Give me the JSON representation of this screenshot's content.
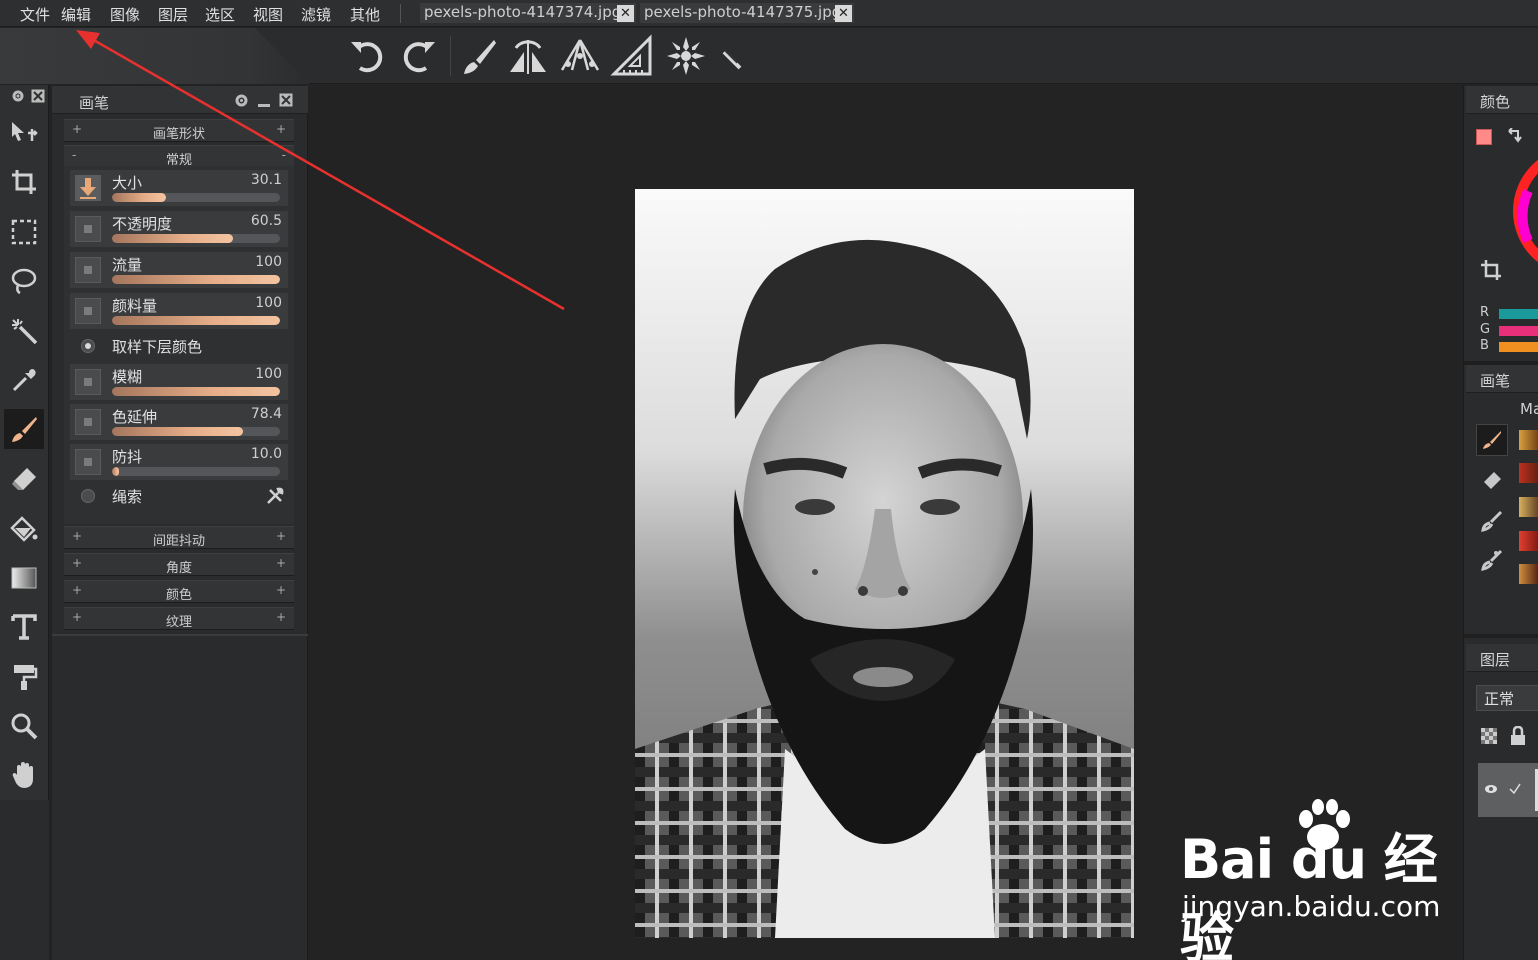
{
  "menubar": {
    "items": [
      "文件",
      "编辑",
      "图像",
      "图层",
      "选区",
      "视图",
      "滤镜",
      "其他"
    ],
    "tabs": [
      {
        "label": "pexels-photo-4147374.jpg"
      },
      {
        "label": "pexels-photo-4147375.jpg"
      }
    ]
  },
  "toolbar": {
    "buttons": [
      "undo-icon",
      "redo-icon",
      "brush-icon",
      "symmetry-icon",
      "perspective-icon",
      "ruler-icon",
      "mandala-icon",
      "pen-icon"
    ]
  },
  "tools": [
    "move-icon",
    "crop-icon",
    "marquee-icon",
    "lasso-icon",
    "magic-wand-icon",
    "eyedropper-icon",
    "brush-icon",
    "eraser-icon",
    "fill-icon",
    "gradient-icon",
    "text-icon",
    "paint-roller-icon",
    "zoom-icon",
    "hand-icon"
  ],
  "brush_panel": {
    "title": "画笔",
    "sections_top": [
      {
        "label": "画笔形状",
        "sign": "+"
      },
      {
        "label": "常规",
        "sign": "-"
      }
    ],
    "params": [
      {
        "label": "大小",
        "value": "30.1",
        "fraction": 0.32
      },
      {
        "label": "不透明度",
        "value": "60.5",
        "fraction": 0.72
      },
      {
        "label": "流量",
        "value": "100",
        "fraction": 1.0
      },
      {
        "label": "颜料量",
        "value": "100",
        "fraction": 1.0
      }
    ],
    "sample_option": "取样下层颜色",
    "params2": [
      {
        "label": "模糊",
        "value": "100",
        "fraction": 1.0
      },
      {
        "label": "色延伸",
        "value": "78.4",
        "fraction": 0.78
      },
      {
        "label": "防抖",
        "value": "10.0",
        "fraction": 0.04
      }
    ],
    "rope_option": "绳索",
    "sections_bottom": [
      {
        "label": "间距抖动",
        "sign": "+"
      },
      {
        "label": "角度",
        "sign": "+"
      },
      {
        "label": "颜色",
        "sign": "+"
      },
      {
        "label": "纹理",
        "sign": "+"
      }
    ]
  },
  "right_panel": {
    "color_title": "颜色",
    "rgb": [
      {
        "label": "R",
        "color": "#1a9a9a"
      },
      {
        "label": "G",
        "color": "#e8307a"
      },
      {
        "label": "B",
        "color": "#f09020"
      }
    ],
    "brush_title": "画笔",
    "brush_preset_label": "Ma",
    "layers_title": "图层",
    "blend_mode": "正常"
  },
  "watermark": {
    "line1": "Bai du 经验",
    "line2": "jingyan.baidu.com"
  },
  "colors": {
    "arrow": "#e8312f",
    "accent_fill": "#e6ad88"
  }
}
